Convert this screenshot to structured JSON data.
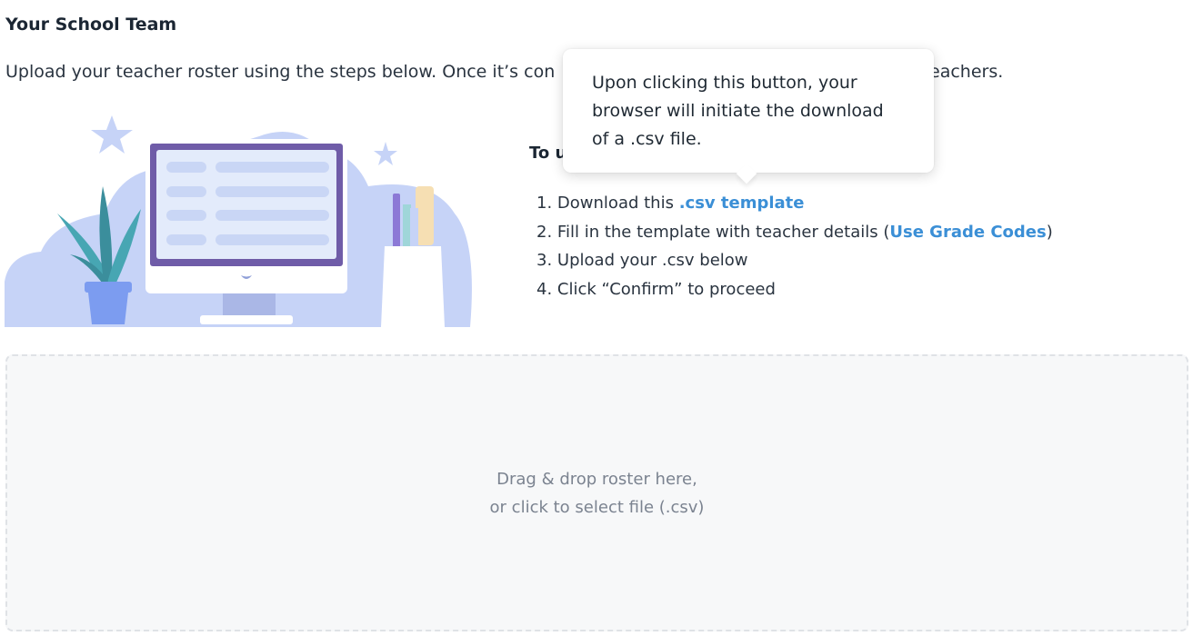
{
  "header": {
    "title": "Your School Team",
    "intro_visible": "Upload your teacher roster using the steps below. Once it’s con",
    "intro_tail": "eachers."
  },
  "instructions": {
    "title_visible": "To u",
    "steps": [
      {
        "number": "1.",
        "text": "Download this ",
        "link": ".csv template",
        "after": ""
      },
      {
        "number": "2.",
        "text": "Fill in the template with teacher details (",
        "link": "Use Grade Codes",
        "after": ")"
      },
      {
        "number": "3.",
        "text": "Upload your .csv below"
      },
      {
        "number": "4.",
        "text": "Click “Confirm” to proceed"
      }
    ]
  },
  "tooltip": {
    "lines": [
      "Upon clicking this button, your",
      "browser will initiate the download",
      "of a .csv file."
    ]
  },
  "dropzone": {
    "line1": "Drag & drop roster here,",
    "line2": "or click to select file (.csv)"
  },
  "colors": {
    "link": "#3b8fd6",
    "illustration_cloud": "#c6d3f7",
    "monitor_frame": "#6f5ca8",
    "plant": "#47a6b3",
    "pot": "#7c9cf0"
  }
}
